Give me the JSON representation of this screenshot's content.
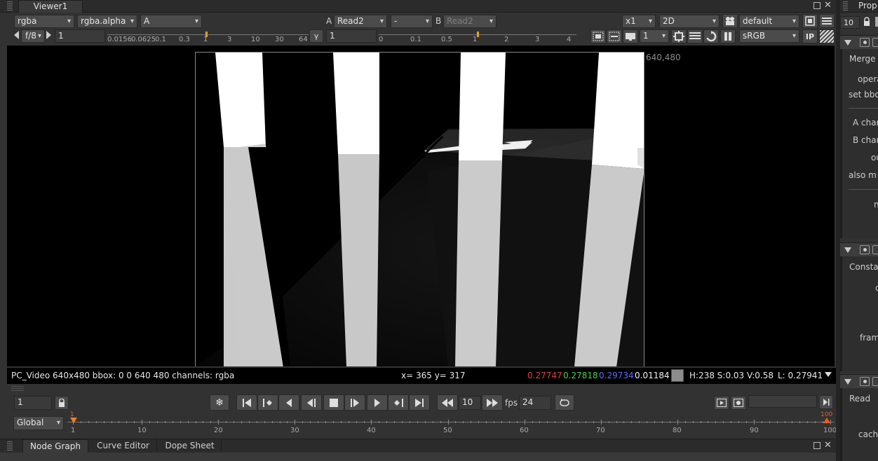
{
  "viewer": {
    "tab_label": "Viewer1",
    "channels": "rgba",
    "channel_alpha": "rgba.alpha",
    "input_a": "A",
    "a_label": "A",
    "a_node": "Read2",
    "compare_mode": "-",
    "b_label": "B",
    "b_node": "Read2",
    "zoom": "x1",
    "view_mode": "2D",
    "lut_default": "default",
    "fstop": "f/8",
    "gain_value": "1",
    "gain_ticks": [
      "0.0156",
      "0.0625",
      "0.1",
      "0.3",
      "1",
      "3",
      "10",
      "30",
      "64"
    ],
    "gamma_label": "γ",
    "gamma_value": "1",
    "gamma_ticks": [
      "0",
      "0.1",
      "0.5",
      "1",
      "2",
      "3",
      "4"
    ],
    "proxy_scale": "1",
    "colorspace": "sRGB",
    "ip_label": "IP",
    "format_label": "640,480",
    "image_alt": "Rendered image: white pillars on dark floor with shadows"
  },
  "status": {
    "info": "PC_Video 640x480 bbox: 0 0 640 480 channels: rgba",
    "coords": "x= 365 y= 317",
    "r": "0.27747",
    "g": "0.27818",
    "b": "0.29734",
    "a": "0.01184",
    "hsv": "H:238 S:0.03 V:0.58",
    "lum": "L: 0.27941",
    "colors": {
      "r": "#e04040",
      "g": "#4ccf4c",
      "b": "#5b6cff",
      "a": "#f0f0f0"
    }
  },
  "playback": {
    "frame": "1",
    "skip_frames": "10",
    "fps_label": "fps",
    "fps_value": "24",
    "global_label": "Global",
    "timeline_ticks": [
      "1",
      "10",
      "20",
      "30",
      "40",
      "50",
      "60",
      "70",
      "80",
      "90",
      "100"
    ],
    "in_frame": "1",
    "out_frame": "100"
  },
  "bottom_tabs": [
    "Node Graph",
    "Curve Editor",
    "Dope Sheet"
  ],
  "properties": {
    "title": "Prop",
    "max_panels": "10",
    "merge_panel": {
      "title": "Merge",
      "rows": [
        "opera",
        "set bbo",
        "A chan",
        "B chan",
        "ou",
        "also m",
        "n"
      ]
    },
    "constant_panel": {
      "title": "Consta",
      "rows": [
        "c",
        "fram"
      ]
    },
    "read_panel": {
      "title": "Read",
      "rows": [
        "cache"
      ]
    }
  }
}
